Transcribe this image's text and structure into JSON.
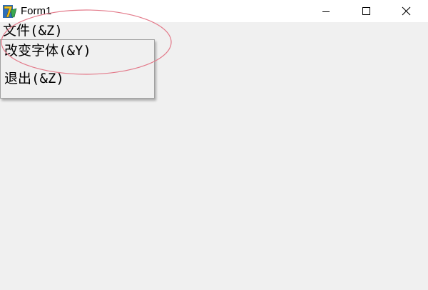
{
  "window": {
    "title": "Form1",
    "app_icon": "delphi-app-icon",
    "controls": {
      "minimize_icon": "minimize-icon",
      "maximize_icon": "maximize-icon",
      "close_icon": "close-icon"
    }
  },
  "menubar": {
    "file_label": "文件(&Z)"
  },
  "dropdown": {
    "items": [
      {
        "label": "改变字体(&Y)"
      },
      {
        "label": "退出(&Z)"
      }
    ]
  },
  "colors": {
    "titlebar_bg": "#ffffff",
    "client_bg": "#f0f0f0",
    "annotation_ellipse": "#e37a8a"
  }
}
